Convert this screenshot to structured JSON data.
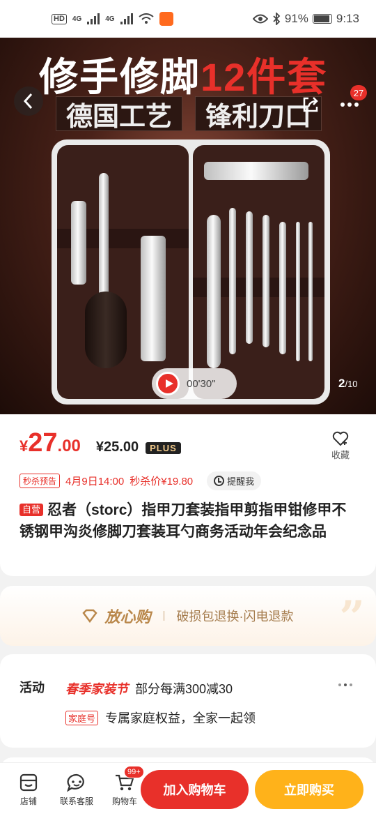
{
  "status_bar": {
    "network_a": "4G",
    "network_b": "4G",
    "battery": "91%",
    "time": "9:13",
    "icons": [
      "hd-icon",
      "signal-icon",
      "wifi-icon",
      "app-notification-icon",
      "eye-icon",
      "bluetooth-icon",
      "battery-icon"
    ]
  },
  "hero": {
    "title_white": "修手修脚",
    "title_red": "12件套",
    "chip_left": "德国工艺",
    "chip_right": "锋利刀口",
    "more_count": "27",
    "video_duration": "00'30\"",
    "page_current": "2",
    "page_total": "/10"
  },
  "price": {
    "currency": "¥",
    "integer": "27",
    "decimal": ".00",
    "plus_price": "¥25.00",
    "plus_tag": "PLUS"
  },
  "favorite": {
    "label": "收藏"
  },
  "flash_sale": {
    "tag": "秒杀预告",
    "date": "4月9日14:00",
    "price": "秒杀价¥19.80",
    "remind": "提醒我"
  },
  "product": {
    "self_tag": "自营",
    "title": "忍者（storc）指甲刀套装指甲剪指甲钳修甲不锈钢甲沟炎修脚刀套装耳勺商务活动年会纪念品"
  },
  "guarantee": {
    "title": "放心购",
    "desc": "破损包退换·闪电退款"
  },
  "activity": {
    "label": "活动",
    "festival": "春季家装节",
    "festival_desc": "部分每满300减30",
    "family_tag": "家庭号",
    "family_desc": "专属家庭权益，全家一起领"
  },
  "bottom_bar": {
    "store": "店铺",
    "service": "联系客服",
    "cart": "购物车",
    "cart_badge": "99+",
    "add_to_cart": "加入购物车",
    "buy_now": "立即购买"
  },
  "colors": {
    "accent_red": "#e8302a",
    "buy_yellow": "#ffb21a",
    "guarantee_gold": "#b9874a"
  }
}
